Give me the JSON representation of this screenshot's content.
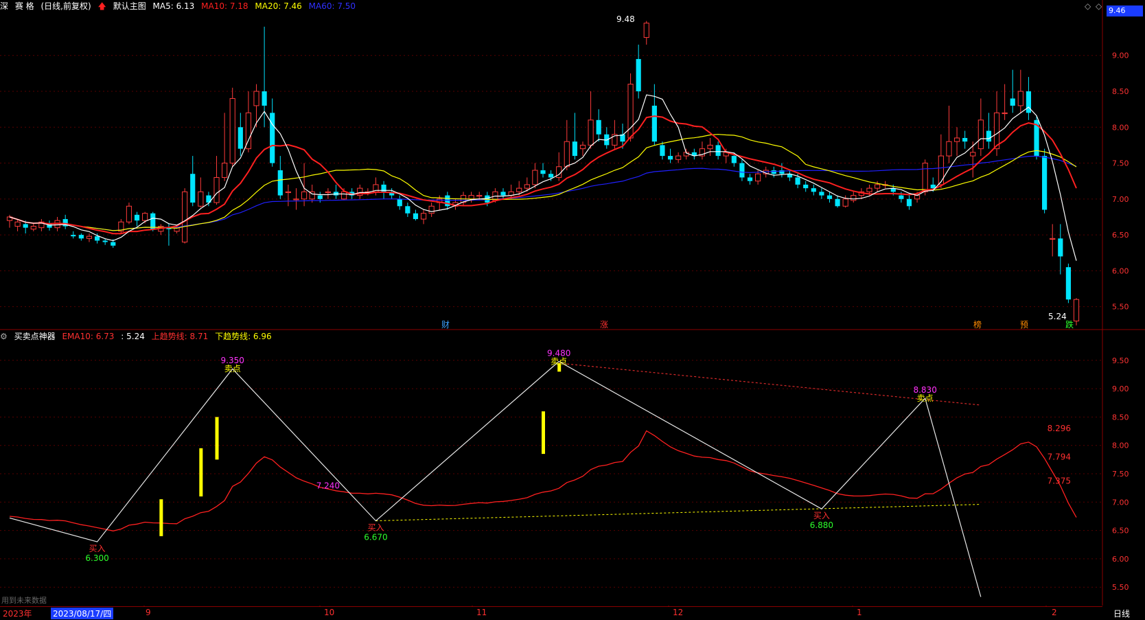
{
  "header_main": {
    "market": "深",
    "name": "赛 格",
    "mode": "(日线,前复权)",
    "template": "默认主图",
    "ma5": "MA5: 6.13",
    "ma10": "MA10: 7.18",
    "ma20": "MA20: 7.46",
    "ma60": "MA60: 7.50",
    "price_box": "9.46"
  },
  "header_sub": {
    "indicator": "买卖点神器",
    "ema10": "EMA10: 6.73",
    "value": ": 5.24",
    "up_trend": "上趋势线: 8.71",
    "down_trend": "下趋势线: 6.96"
  },
  "footer": {
    "note": "用到未来数据",
    "year": "2023年",
    "cursor_date": "2023/08/17/四",
    "months": [
      "9",
      "10",
      "11",
      "12",
      "1",
      "2"
    ],
    "period": "日线"
  },
  "markers": {
    "cai": "财",
    "zhang": "涨",
    "bang": "榜",
    "yu": "预",
    "die": "跌",
    "high_label": "9.48",
    "low_label": "5.24"
  },
  "colors": {
    "up": "#ff3b3b",
    "down": "#00e5ff",
    "ma5": "#ffffff",
    "ma10": "#ff2020",
    "ma20": "#ffff00",
    "ma60": "#2020ff",
    "grid": "#5a0000",
    "sub_axis": "#ff3333"
  },
  "chart_data": [
    {
      "type": "candlestick",
      "title": "赛 格(日线,前复权)",
      "ylim": [
        5.2,
        9.6
      ],
      "yticks": [
        5.5,
        6.0,
        6.5,
        7.0,
        7.5,
        8.0,
        8.5,
        9.0
      ],
      "high": 9.48,
      "low": 5.24,
      "candles": [
        [
          6.7,
          6.75,
          6.6,
          6.78
        ],
        [
          6.62,
          6.68,
          6.55,
          6.72
        ],
        [
          6.65,
          6.6,
          6.52,
          6.7
        ],
        [
          6.58,
          6.62,
          6.55,
          6.66
        ],
        [
          6.6,
          6.68,
          6.55,
          6.72
        ],
        [
          6.65,
          6.6,
          6.56,
          6.7
        ],
        [
          6.6,
          6.7,
          6.55,
          6.75
        ],
        [
          6.72,
          6.62,
          6.58,
          6.78
        ],
        [
          6.5,
          6.48,
          6.45,
          6.55
        ],
        [
          6.5,
          6.45,
          6.42,
          6.52
        ],
        [
          6.45,
          6.48,
          6.4,
          6.52
        ],
        [
          6.48,
          6.42,
          6.38,
          6.52
        ],
        [
          6.42,
          6.4,
          6.36,
          6.45
        ],
        [
          6.4,
          6.35,
          6.32,
          6.44
        ],
        [
          6.55,
          6.68,
          6.52,
          6.72
        ],
        [
          6.68,
          6.9,
          6.65,
          6.95
        ],
        [
          6.78,
          6.7,
          6.62,
          6.82
        ],
        [
          6.7,
          6.8,
          6.66,
          6.82
        ],
        [
          6.8,
          6.58,
          6.55,
          6.82
        ],
        [
          6.55,
          6.62,
          6.5,
          6.65
        ],
        [
          6.6,
          6.58,
          6.35,
          6.65
        ],
        [
          6.55,
          6.6,
          6.52,
          6.62
        ],
        [
          6.4,
          7.1,
          6.38,
          7.15
        ],
        [
          7.35,
          6.95,
          6.9,
          7.6
        ],
        [
          6.9,
          7.1,
          6.88,
          7.3
        ],
        [
          7.05,
          6.95,
          6.9,
          7.1
        ],
        [
          6.95,
          7.3,
          6.92,
          7.6
        ],
        [
          7.3,
          7.5,
          7.25,
          8.2
        ],
        [
          7.5,
          8.4,
          7.45,
          8.55
        ],
        [
          8.0,
          7.7,
          7.6,
          8.2
        ],
        [
          7.7,
          8.2,
          7.65,
          8.5
        ],
        [
          8.3,
          8.5,
          8.0,
          8.6
        ],
        [
          8.5,
          8.3,
          8.0,
          9.4
        ],
        [
          8.2,
          7.5,
          7.45,
          8.4
        ],
        [
          7.4,
          7.05,
          7.0,
          7.6
        ],
        [
          7.1,
          7.1,
          6.9,
          7.2
        ],
        [
          7.0,
          7.0,
          6.85,
          7.15
        ],
        [
          7.0,
          7.1,
          6.9,
          7.5
        ],
        [
          7.0,
          7.1,
          6.95,
          7.2
        ],
        [
          7.05,
          7.0,
          6.95,
          7.1
        ],
        [
          7.1,
          7.1,
          7.0,
          7.15
        ],
        [
          7.1,
          7.05,
          7.0,
          7.2
        ],
        [
          7.0,
          7.1,
          6.98,
          7.15
        ],
        [
          7.1,
          7.05,
          7.0,
          7.15
        ],
        [
          7.05,
          7.15,
          7.0,
          7.2
        ],
        [
          7.1,
          7.1,
          7.05,
          7.15
        ],
        [
          7.1,
          7.2,
          7.05,
          7.3
        ],
        [
          7.2,
          7.1,
          7.0,
          7.25
        ],
        [
          7.1,
          7.05,
          7.0,
          7.15
        ],
        [
          7.0,
          6.9,
          6.85,
          7.05
        ],
        [
          6.9,
          6.8,
          6.75,
          6.95
        ],
        [
          6.8,
          6.72,
          6.7,
          6.85
        ],
        [
          6.72,
          6.8,
          6.65,
          6.85
        ],
        [
          6.8,
          6.9,
          6.75,
          6.95
        ],
        [
          6.95,
          7.0,
          6.85,
          7.05
        ],
        [
          7.05,
          6.9,
          6.85,
          7.1
        ],
        [
          6.9,
          6.95,
          6.85,
          7.0
        ],
        [
          6.95,
          7.05,
          6.9,
          7.1
        ],
        [
          7.0,
          7.05,
          6.95,
          7.1
        ],
        [
          7.05,
          7.05,
          6.98,
          7.1
        ],
        [
          7.05,
          6.95,
          6.9,
          7.1
        ],
        [
          6.98,
          7.1,
          6.95,
          7.15
        ],
        [
          7.1,
          7.05,
          7.0,
          7.15
        ],
        [
          7.05,
          7.1,
          7.0,
          7.2
        ],
        [
          7.1,
          7.15,
          7.05,
          7.25
        ],
        [
          7.15,
          7.2,
          7.1,
          7.3
        ],
        [
          7.2,
          7.4,
          7.15,
          7.5
        ],
        [
          7.4,
          7.35,
          7.3,
          7.5
        ],
        [
          7.35,
          7.3,
          7.25,
          7.4
        ],
        [
          7.3,
          7.45,
          7.25,
          7.65
        ],
        [
          7.45,
          7.8,
          7.4,
          8.1
        ],
        [
          7.8,
          7.6,
          7.55,
          8.2
        ],
        [
          7.7,
          7.75,
          7.6,
          7.8
        ],
        [
          7.75,
          8.1,
          7.7,
          8.5
        ],
        [
          8.1,
          7.9,
          7.8,
          8.25
        ],
        [
          7.9,
          7.75,
          7.7,
          8.0
        ],
        [
          7.75,
          7.9,
          7.7,
          8.1
        ],
        [
          7.9,
          7.8,
          7.7,
          8.05
        ],
        [
          7.85,
          8.6,
          7.8,
          8.75
        ],
        [
          8.95,
          8.5,
          8.4,
          9.15
        ],
        [
          9.25,
          9.45,
          9.15,
          9.48
        ],
        [
          8.3,
          7.8,
          7.75,
          8.6
        ],
        [
          7.75,
          7.6,
          7.55,
          7.8
        ],
        [
          7.6,
          7.55,
          7.5,
          7.7
        ],
        [
          7.55,
          7.6,
          7.5,
          7.65
        ],
        [
          7.6,
          7.65,
          7.55,
          7.7
        ],
        [
          7.65,
          7.6,
          7.55,
          7.7
        ],
        [
          7.6,
          7.7,
          7.55,
          7.8
        ],
        [
          7.7,
          7.75,
          7.6,
          7.85
        ],
        [
          7.75,
          7.6,
          7.55,
          7.8
        ],
        [
          7.6,
          7.65,
          7.5,
          7.7
        ],
        [
          7.6,
          7.5,
          7.45,
          7.65
        ],
        [
          7.5,
          7.3,
          7.25,
          7.55
        ],
        [
          7.3,
          7.25,
          7.2,
          7.35
        ],
        [
          7.25,
          7.35,
          7.2,
          7.4
        ],
        [
          7.35,
          7.4,
          7.3,
          7.45
        ],
        [
          7.4,
          7.35,
          7.3,
          7.45
        ],
        [
          7.4,
          7.35,
          7.3,
          7.5
        ],
        [
          7.35,
          7.3,
          7.25,
          7.4
        ],
        [
          7.3,
          7.2,
          7.15,
          7.35
        ],
        [
          7.2,
          7.15,
          7.1,
          7.25
        ],
        [
          7.15,
          7.1,
          7.05,
          7.2
        ],
        [
          7.1,
          7.05,
          7.0,
          7.15
        ],
        [
          7.05,
          7.0,
          6.95,
          7.1
        ],
        [
          7.0,
          6.9,
          6.88,
          7.05
        ],
        [
          6.9,
          7.0,
          6.88,
          7.05
        ],
        [
          6.98,
          7.05,
          6.95,
          7.1
        ],
        [
          7.05,
          7.1,
          7.0,
          7.15
        ],
        [
          7.1,
          7.15,
          7.05,
          7.2
        ],
        [
          7.15,
          7.2,
          7.1,
          7.25
        ],
        [
          7.2,
          7.2,
          7.15,
          7.25
        ],
        [
          7.15,
          7.1,
          7.05,
          7.2
        ],
        [
          7.05,
          7.0,
          6.95,
          7.1
        ],
        [
          7.0,
          6.9,
          6.85,
          7.05
        ],
        [
          7.0,
          7.05,
          6.95,
          7.1
        ],
        [
          7.1,
          7.5,
          7.05,
          7.55
        ],
        [
          7.2,
          7.15,
          7.1,
          7.3
        ],
        [
          7.2,
          7.6,
          7.15,
          7.9
        ],
        [
          7.6,
          7.8,
          7.5,
          8.3
        ],
        [
          7.8,
          7.85,
          7.6,
          8.0
        ],
        [
          7.85,
          7.8,
          7.7,
          7.95
        ],
        [
          7.6,
          7.65,
          7.3,
          7.8
        ],
        [
          7.7,
          8.1,
          7.6,
          8.4
        ],
        [
          7.95,
          7.8,
          7.7,
          8.2
        ],
        [
          7.7,
          8.2,
          7.6,
          8.5
        ],
        [
          8.2,
          8.2,
          8.1,
          8.6
        ],
        [
          8.4,
          8.3,
          8.2,
          8.8
        ],
        [
          8.3,
          8.5,
          8.2,
          8.8
        ],
        [
          8.5,
          8.2,
          8.1,
          8.7
        ],
        [
          8.1,
          7.6,
          7.55,
          8.15
        ],
        [
          7.6,
          6.85,
          6.8,
          7.7
        ],
        [
          6.45,
          6.45,
          6.2,
          6.65
        ],
        [
          6.45,
          6.2,
          5.95,
          6.65
        ],
        [
          6.05,
          5.6,
          5.55,
          6.1
        ],
        [
          5.3,
          5.6,
          5.24,
          5.62
        ]
      ],
      "ma5_end": 6.13,
      "ma10_end": 7.18,
      "ma20_end": 7.46,
      "ma60_end": 7.5
    },
    {
      "type": "line",
      "title": "买卖点神器",
      "ylim": [
        5.2,
        9.8
      ],
      "yticks": [
        5.5,
        6.0,
        6.5,
        7.0,
        7.5,
        8.0,
        8.5,
        9.0,
        9.5
      ],
      "zigzag": [
        [
          0,
          6.72
        ],
        [
          11,
          6.3
        ],
        [
          28,
          9.35
        ],
        [
          46,
          6.67
        ],
        [
          69,
          9.48
        ],
        [
          102,
          6.88
        ],
        [
          115,
          8.83
        ],
        [
          122,
          5.33
        ]
      ],
      "zigzag_labels": [
        {
          "i": 11,
          "v": "6.300",
          "t": "买入"
        },
        {
          "i": 28,
          "v": "9.350",
          "t": "卖点"
        },
        {
          "i": 40,
          "v": "7.240",
          "t": ""
        },
        {
          "i": 46,
          "v": "6.670",
          "t": "买入"
        },
        {
          "i": 69,
          "v": "9.480",
          "t": "卖点"
        },
        {
          "i": 102,
          "v": "6.880",
          "t": "买入"
        },
        {
          "i": 115,
          "v": "8.830",
          "t": "卖点"
        }
      ],
      "right_values": [
        "8.296",
        "7.794",
        "7.375"
      ],
      "up_trend": [
        [
          69,
          9.45
        ],
        [
          122,
          8.71
        ]
      ],
      "down_trend": [
        [
          46,
          6.67
        ],
        [
          122,
          6.96
        ]
      ],
      "yellow_bars": [
        [
          19,
          6.4,
          7.05
        ],
        [
          24,
          7.1,
          7.95
        ],
        [
          26,
          7.75,
          8.5
        ],
        [
          67,
          7.85,
          8.6
        ],
        [
          69,
          9.3,
          9.45
        ]
      ]
    }
  ]
}
